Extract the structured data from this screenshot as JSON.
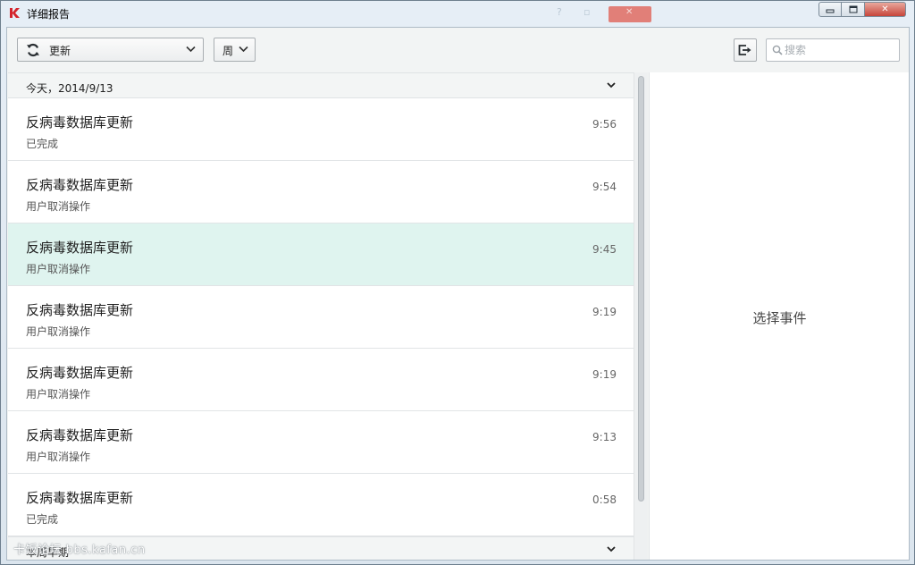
{
  "window": {
    "title": "详细报告",
    "min_glyph": "▭",
    "max_glyph": "▢",
    "close_glyph": "✕"
  },
  "toolbar": {
    "update_dropdown": {
      "label": "更新",
      "icon": "refresh-icon"
    },
    "period_dropdown": {
      "label": "周"
    },
    "export_icon": "export-icon",
    "search": {
      "placeholder": "搜索",
      "value": ""
    }
  },
  "list": {
    "groups": [
      {
        "header": "今天，2014/9/13",
        "events": [
          {
            "title": "反病毒数据库更新",
            "status": "已完成",
            "time": "9:56",
            "selected": false
          },
          {
            "title": "反病毒数据库更新",
            "status": "用户取消操作",
            "time": "9:54",
            "selected": false
          },
          {
            "title": "反病毒数据库更新",
            "status": "用户取消操作",
            "time": "9:45",
            "selected": true
          },
          {
            "title": "反病毒数据库更新",
            "status": "用户取消操作",
            "time": "9:19",
            "selected": false
          },
          {
            "title": "反病毒数据库更新",
            "status": "用户取消操作",
            "time": "9:19",
            "selected": false
          },
          {
            "title": "反病毒数据库更新",
            "status": "用户取消操作",
            "time": "9:13",
            "selected": false
          },
          {
            "title": "反病毒数据库更新",
            "status": "已完成",
            "time": "0:58",
            "selected": false
          }
        ]
      },
      {
        "header": "本周早期",
        "events": []
      }
    ]
  },
  "detail": {
    "placeholder": "选择事件"
  },
  "watermark": "卡饭论坛 bbs.kafan.cn",
  "colors": {
    "selected_row": "#dff4ef",
    "accent_red": "#c6453a",
    "logo_red": "#d4242c"
  }
}
